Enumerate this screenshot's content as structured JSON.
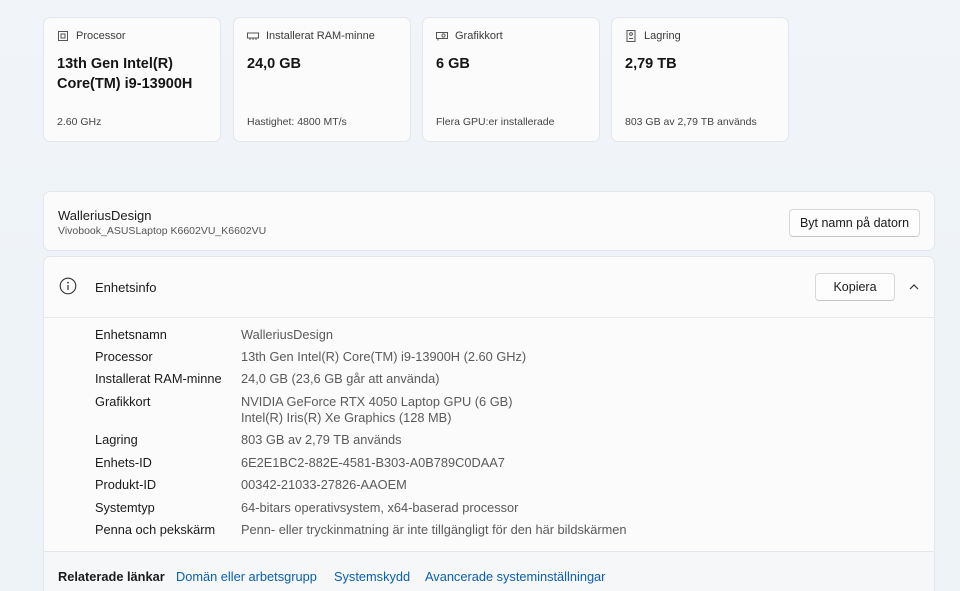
{
  "cards": [
    {
      "header": "Processor",
      "value": "13th Gen Intel(R) Core(TM) i9-13900H",
      "sub": "2.60 GHz",
      "icon": "processor-icon"
    },
    {
      "header": "Installerat RAM-minne",
      "value": "24,0 GB",
      "sub": "Hastighet: 4800 MT/s",
      "icon": "ram-icon"
    },
    {
      "header": "Grafikkort",
      "value": "6 GB",
      "sub": "Flera GPU:er installerade",
      "icon": "gpu-icon"
    },
    {
      "header": "Lagring",
      "value": "2,79 TB",
      "sub": "803 GB av 2,79 TB används",
      "icon": "storage-icon"
    }
  ],
  "device": {
    "name": "WalleriusDesign",
    "model": "Vivobook_ASUSLaptop K6602VU_K6602VU",
    "rename_label": "Byt namn på datorn"
  },
  "info": {
    "title": "Enhetsinfo",
    "copy_label": "Kopiera",
    "rows": [
      {
        "key": "Enhetsnamn",
        "value": "WalleriusDesign"
      },
      {
        "key": "Processor",
        "value": "13th Gen Intel(R) Core(TM) i9-13900H (2.60 GHz)"
      },
      {
        "key": "Installerat RAM-minne",
        "value": "24,0 GB (23,6 GB går att använda)"
      },
      {
        "key": "Grafikkort",
        "value": "NVIDIA GeForce RTX 4050 Laptop GPU (6 GB)",
        "value2": "Intel(R) Iris(R) Xe Graphics (128 MB)"
      },
      {
        "key": "Lagring",
        "value": "803 GB av 2,79 TB används"
      },
      {
        "key": "Enhets-ID",
        "value": "6E2E1BC2-882E-4581-B303-A0B789C0DAA7"
      },
      {
        "key": "Produkt-ID",
        "value": "00342-21033-27826-AAOEM"
      },
      {
        "key": "Systemtyp",
        "value": "64-bitars operativsystem, x64-baserad processor"
      },
      {
        "key": "Penna och pekskärm",
        "value": "Penn- eller tryckinmatning är inte tillgängligt för den här bildskärmen"
      }
    ]
  },
  "related": {
    "label": "Relaterade länkar",
    "links": [
      "Domän eller arbetsgrupp",
      "Systemskydd",
      "Avancerade systeminställningar"
    ]
  }
}
